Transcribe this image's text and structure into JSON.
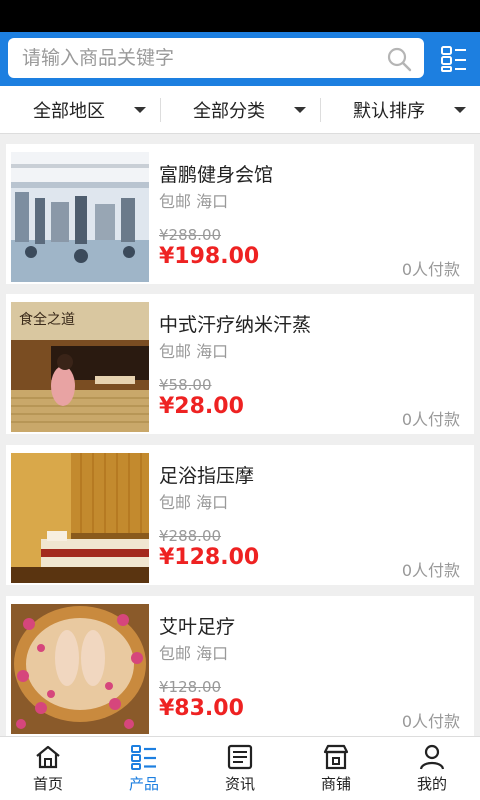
{
  "search": {
    "placeholder": "请输入商品关键字"
  },
  "filters": [
    {
      "label": "全部地区"
    },
    {
      "label": "全部分类"
    },
    {
      "label": "默认排序"
    }
  ],
  "products": [
    {
      "title": "富鹏健身会馆",
      "meta": "包邮 海口",
      "old_price": "¥288.00",
      "price": "¥198.00",
      "sold": "0人付款"
    },
    {
      "title": "中式汗疗纳米汗蒸",
      "meta": "包邮 海口",
      "old_price": "¥58.00",
      "price": "¥28.00",
      "sold": "0人付款"
    },
    {
      "title": "足浴指压摩",
      "meta": "包邮 海口",
      "old_price": "¥288.00",
      "price": "¥128.00",
      "sold": "0人付款"
    },
    {
      "title": "艾叶足疗",
      "meta": "包邮 海口",
      "old_price": "¥128.00",
      "price": "¥83.00",
      "sold": "0人付款"
    }
  ],
  "nav": [
    {
      "label": "首页",
      "icon": "home-icon"
    },
    {
      "label": "产品",
      "icon": "product-list-icon"
    },
    {
      "label": "资讯",
      "icon": "news-icon"
    },
    {
      "label": "商铺",
      "icon": "shop-icon"
    },
    {
      "label": "我的",
      "icon": "user-icon"
    }
  ],
  "colors": {
    "brand": "#1d7fe0",
    "price": "#e22222"
  }
}
